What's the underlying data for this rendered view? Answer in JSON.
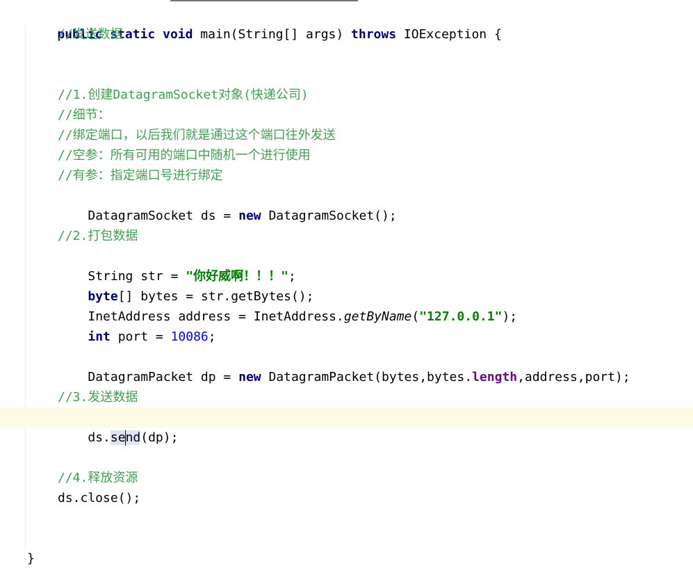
{
  "editor": {
    "lines": {
      "method_sig": {
        "kw_public": "public",
        "kw_static": "static",
        "kw_void": "void",
        "name_params": " main(String[] args) ",
        "kw_throws": "throws",
        "exception": " IOException {"
      },
      "comment_send": "//发送数据",
      "comment_step1": "//1.创建DatagramSocket对象(快递公司)",
      "comment_detail": "//细节：",
      "comment_bind": "//绑定端口，以后我们就是通过这个端口往外发送",
      "comment_empty_param": "//空参：所有可用的端口中随机一个进行使用",
      "comment_with_param": "//有参：指定端口号进行绑定",
      "socket_decl": {
        "lhs": "DatagramSocket ds = ",
        "kw_new": "new",
        "rhs": " DatagramSocket();"
      },
      "comment_step2": "//2.打包数据",
      "str_decl": {
        "lhs": "String str = ",
        "literal": "\"你好威啊！！！\"",
        "end": ";"
      },
      "bytes_decl": {
        "kw_byte": "byte",
        "rest": "[] bytes = str.getBytes();"
      },
      "address_decl": {
        "lhs": "InetAddress address = InetAddress.",
        "method": "getByName",
        "open": "(",
        "literal": "\"127.0.0.1\"",
        "close": ");"
      },
      "port_decl": {
        "kw_int": "int",
        "middle": " port = ",
        "number": "10086",
        "end": ";"
      },
      "packet_decl": {
        "lhs": "DatagramPacket dp = ",
        "kw_new": "new",
        "args_start": " DatagramPacket(bytes,bytes.",
        "field": "length",
        "args_end": ",address,port);"
      },
      "comment_step3": "//3.发送数据",
      "send_call": {
        "prefix": "ds.",
        "method_before_cursor": "se",
        "method_after_cursor": "nd",
        "args": "(dp);"
      },
      "comment_step4": "//4.释放资源",
      "close_call": "ds.close();",
      "closing_brace": "}"
    }
  },
  "colors": {
    "keyword": "#000080",
    "comment": "#409f52",
    "string": "#008000",
    "number": "#0000ff",
    "field": "#660e7a",
    "current_line": "#fdfae6",
    "caret_highlight": "#e0e4f7"
  }
}
